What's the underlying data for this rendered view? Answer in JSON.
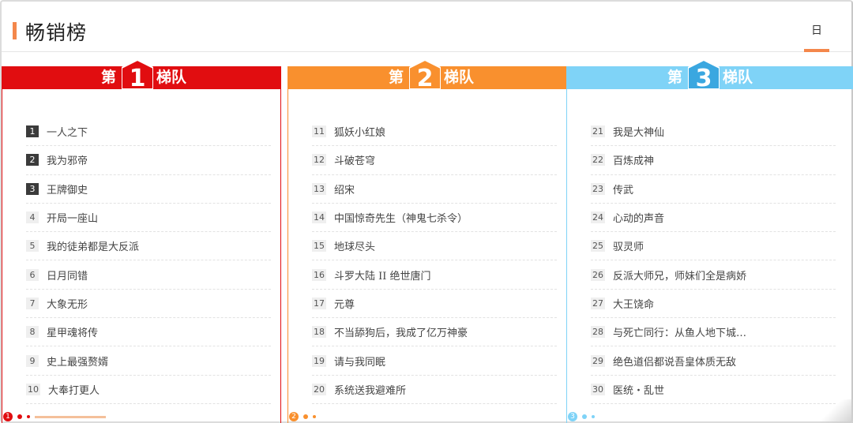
{
  "header": {
    "title": "畅销榜",
    "tab_day": "日"
  },
  "colors": {
    "accent": "#f4874b",
    "tier1": "#e10d10",
    "tier2": "#f9902e",
    "tier3": "#7fd3f7"
  },
  "tiers": [
    {
      "prefix": "第",
      "number": "1",
      "suffix": "梯队",
      "items": [
        {
          "rank": "1",
          "title": "一人之下"
        },
        {
          "rank": "2",
          "title": "我为邪帝"
        },
        {
          "rank": "3",
          "title": "王牌御史"
        },
        {
          "rank": "4",
          "title": "开局一座山"
        },
        {
          "rank": "5",
          "title": "我的徒弟都是大反派"
        },
        {
          "rank": "6",
          "title": "日月同错"
        },
        {
          "rank": "7",
          "title": "大象无形"
        },
        {
          "rank": "8",
          "title": "星甲魂将传"
        },
        {
          "rank": "9",
          "title": "史上最强赘婿"
        },
        {
          "rank": "10",
          "title": "大奉打更人"
        }
      ]
    },
    {
      "prefix": "第",
      "number": "2",
      "suffix": "梯队",
      "items": [
        {
          "rank": "11",
          "title": "狐妖小红娘"
        },
        {
          "rank": "12",
          "title": "斗破苍穹"
        },
        {
          "rank": "13",
          "title": "绍宋"
        },
        {
          "rank": "14",
          "title": "中国惊奇先生（神鬼七杀令）"
        },
        {
          "rank": "15",
          "title": "地球尽头"
        },
        {
          "rank": "16",
          "title": "斗罗大陆 II 绝世唐门"
        },
        {
          "rank": "17",
          "title": "元尊"
        },
        {
          "rank": "18",
          "title": "不当舔狗后，我成了亿万神豪"
        },
        {
          "rank": "19",
          "title": "请与我同眠"
        },
        {
          "rank": "20",
          "title": "系统送我避难所"
        }
      ]
    },
    {
      "prefix": "第",
      "number": "3",
      "suffix": "梯队",
      "items": [
        {
          "rank": "21",
          "title": "我是大神仙"
        },
        {
          "rank": "22",
          "title": "百炼成神"
        },
        {
          "rank": "23",
          "title": "传武"
        },
        {
          "rank": "24",
          "title": "心动的声音"
        },
        {
          "rank": "25",
          "title": "驭灵师"
        },
        {
          "rank": "26",
          "title": "反派大师兄，师妹们全是病娇"
        },
        {
          "rank": "27",
          "title": "大王饶命"
        },
        {
          "rank": "28",
          "title": "与死亡同行：从鱼人地下城…"
        },
        {
          "rank": "29",
          "title": "绝色道侣都说吾皇体质无敌"
        },
        {
          "rank": "30",
          "title": "医统・乱世"
        }
      ]
    }
  ],
  "footer_markers": [
    "1",
    "2",
    "3"
  ]
}
